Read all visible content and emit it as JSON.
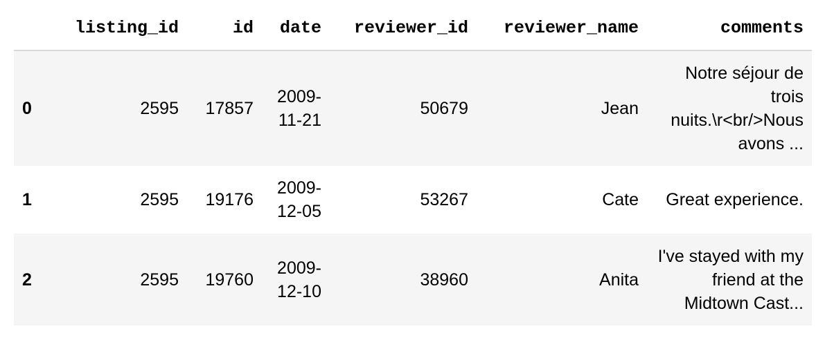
{
  "table": {
    "columns": [
      "",
      "listing_id",
      "id",
      "date",
      "reviewer_id",
      "reviewer_name",
      "comments"
    ],
    "rows": [
      {
        "index": "0",
        "listing_id": "2595",
        "id": "17857",
        "date": "2009-11-21",
        "reviewer_id": "50679",
        "reviewer_name": "Jean",
        "comments": "Notre séjour de trois nuits.\\r<br/>Nous avons ..."
      },
      {
        "index": "1",
        "listing_id": "2595",
        "id": "19176",
        "date": "2009-12-05",
        "reviewer_id": "53267",
        "reviewer_name": "Cate",
        "comments": "Great experience."
      },
      {
        "index": "2",
        "listing_id": "2595",
        "id": "19760",
        "date": "2009-12-10",
        "reviewer_id": "38960",
        "reviewer_name": "Anita",
        "comments": "I've stayed with my friend at the Midtown Cast..."
      }
    ]
  }
}
